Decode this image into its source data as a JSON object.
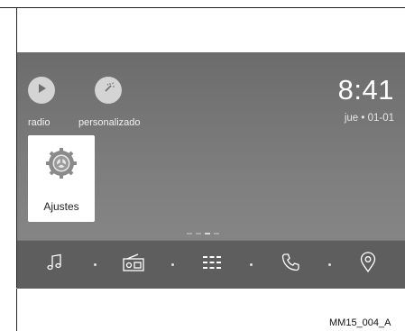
{
  "home": {
    "shortcuts": [
      {
        "label": "radio",
        "icon": "play-icon"
      },
      {
        "label": "personalizado",
        "icon": "magic-wand-icon"
      }
    ],
    "clock": {
      "time": "8:41",
      "date": "jue • 01-01"
    },
    "tiles": [
      {
        "label": "Ajustes",
        "icon": "settings-gear-icon"
      }
    ],
    "page_indicator": {
      "count": 4,
      "active": 2
    }
  },
  "bottom_bar": {
    "items": [
      {
        "name": "music",
        "icon": "music-note-icon"
      },
      {
        "name": "radio",
        "icon": "radio-icon"
      },
      {
        "name": "apps",
        "icon": "app-grid-icon"
      },
      {
        "name": "phone",
        "icon": "phone-icon"
      },
      {
        "name": "navigation",
        "icon": "map-pin-icon"
      }
    ]
  },
  "caption": "MM15_004_A",
  "colors": {
    "screen_bg": "#777777",
    "bar_bg": "#5e5e5e",
    "icon_bg": "#d4d4d4",
    "text_light": "#ffffff"
  }
}
